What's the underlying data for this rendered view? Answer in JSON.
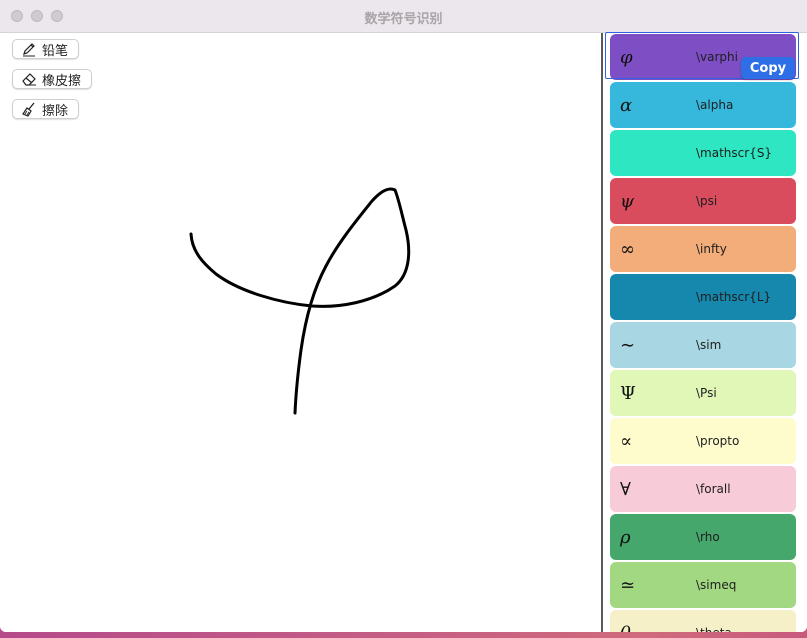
{
  "window": {
    "title": "数学符号识别"
  },
  "tools": [
    {
      "label": "铅笔",
      "icon": "pencil-icon"
    },
    {
      "label": "橡皮擦",
      "icon": "eraser-icon"
    },
    {
      "label": "擦除",
      "icon": "broom-icon"
    }
  ],
  "copy_label": "Copy",
  "results": [
    {
      "symbol": "φ",
      "latex": "\\varphi",
      "color": "#7e4fc4",
      "selected": true
    },
    {
      "symbol": "α",
      "latex": "\\alpha",
      "color": "#36b8dd"
    },
    {
      "symbol": "",
      "latex": "\\mathscr{S}",
      "color": "#2ee6c2"
    },
    {
      "symbol": "ψ",
      "latex": "\\psi",
      "color": "#d94c5e"
    },
    {
      "symbol": "∞",
      "latex": "\\infty",
      "color": "#f2ad7a"
    },
    {
      "symbol": "",
      "latex": "\\mathscr{L}",
      "color": "#1688ae"
    },
    {
      "symbol": "∼",
      "latex": "\\sim",
      "color": "#a8d6e2"
    },
    {
      "symbol": "Ψ",
      "latex": "\\Psi",
      "color": "#e0f7b8"
    },
    {
      "symbol": "∝",
      "latex": "\\propto",
      "color": "#fefccc"
    },
    {
      "symbol": "∀",
      "latex": "\\forall",
      "color": "#f7cbd8"
    },
    {
      "symbol": "ρ",
      "latex": "\\rho",
      "color": "#45a76c"
    },
    {
      "symbol": "≃",
      "latex": "\\simeq",
      "color": "#a2d882"
    },
    {
      "symbol": "θ",
      "latex": "\\theta",
      "color": "#f5f0c8"
    }
  ]
}
